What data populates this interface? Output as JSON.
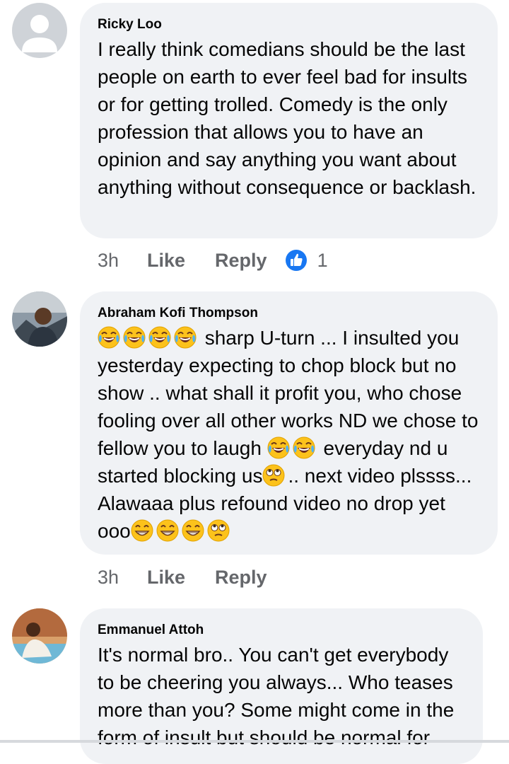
{
  "comments": [
    {
      "author": "Ricky Loo",
      "avatar": "default-avatar",
      "text": "I really think comedians should be the last people on earth to ever feel bad for insults or for getting trolled. Comedy is the only profession that allows you to have an opinion and say anything you want about anything without consequence or backlash.",
      "time": "3h",
      "like_label": "Like",
      "reply_label": "Reply",
      "reaction_count": "1"
    },
    {
      "author": "Abraham Kofi Thompson",
      "avatar": "user-photo",
      "text_parts": {
        "p1": "sharp U-turn ... I insulted you yesterday expecting to chop block but no show .. what shall it profit you, who chose fooling over all other works ND we chose to fellow you to laugh",
        "p2": "everyday nd u started blocking us",
        "p3": ".. next video plssss... Alawaaa plus refound video no drop yet ooo"
      },
      "time": "3h",
      "like_label": "Like",
      "reply_label": "Reply"
    },
    {
      "author": "Emmanuel Attoh",
      "avatar": "user-photo",
      "text": "It's normal bro.. You can't get everybody to be cheering you always... Who teases more than you? Some might come in the form of insult but should be normal for"
    }
  ],
  "colors": {
    "bubble": "#f0f2f5",
    "meta_text": "#65676b",
    "like_blue": "#1877f2"
  }
}
